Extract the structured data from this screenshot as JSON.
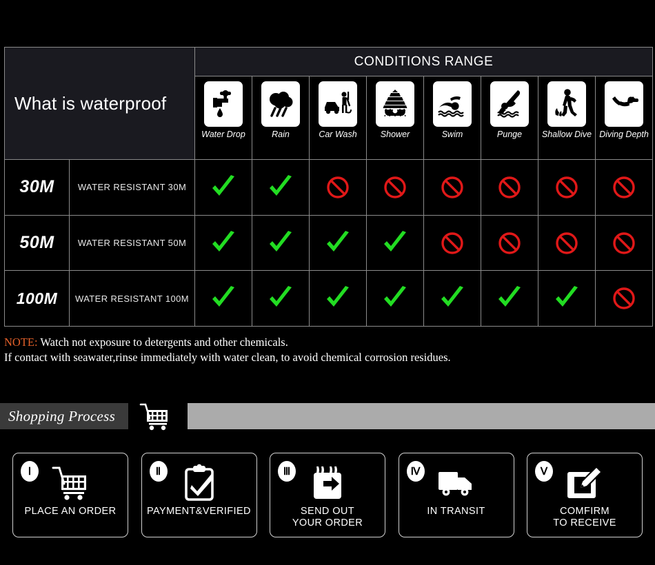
{
  "table": {
    "title": "What is waterproof",
    "conditions_header": "CONDITIONS RANGE",
    "columns": [
      {
        "label": "Water Drop",
        "icon": "faucet-water-drop-icon"
      },
      {
        "label": "Rain",
        "icon": "rain-cloud-icon"
      },
      {
        "label": "Car Wash",
        "icon": "car-wash-icon"
      },
      {
        "label": "Shower",
        "icon": "shower-icon"
      },
      {
        "label": "Swim",
        "icon": "swimmer-icon"
      },
      {
        "label": "Punge",
        "icon": "plunge-dive-icon"
      },
      {
        "label": "Shallow Dive",
        "icon": "shallow-dive-icon"
      },
      {
        "label": "Diving Depth",
        "icon": "scuba-diver-icon"
      }
    ],
    "rows": [
      {
        "depth": "30M",
        "description": "WATER RESISTANT  30M",
        "marks": [
          "yes",
          "yes",
          "no",
          "no",
          "no",
          "no",
          "no",
          "no"
        ]
      },
      {
        "depth": "50M",
        "description": "WATER RESISTANT 50M",
        "marks": [
          "yes",
          "yes",
          "yes",
          "yes",
          "no",
          "no",
          "no",
          "no"
        ]
      },
      {
        "depth": "100M",
        "description": "WATER RESISTANT  100M",
        "marks": [
          "yes",
          "yes",
          "yes",
          "yes",
          "yes",
          "yes",
          "yes",
          "no"
        ]
      }
    ]
  },
  "note": {
    "keyword": "NOTE:",
    "line1": " Watch not exposure to detergents and other chemicals.",
    "line2": "If contact with seawater,rinse immediately with water clean, to avoid chemical corrosion residues."
  },
  "shopping": {
    "tab_label": "Shopping Process",
    "cart_icon": "shopping-cart-icon",
    "steps": [
      {
        "numeral": "Ⅰ",
        "label": "PLACE AN ORDER",
        "icon": "shopping-cart-icon"
      },
      {
        "numeral": "Ⅱ",
        "label": "PAYMENT&VERIFIED",
        "icon": "clipboard-check-icon"
      },
      {
        "numeral": "Ⅲ",
        "label": "SEND OUT\nYOUR ORDER",
        "icon": "calendar-arrow-icon"
      },
      {
        "numeral": "Ⅳ",
        "label": "IN TRANSIT",
        "icon": "delivery-truck-icon"
      },
      {
        "numeral": "Ⅴ",
        "label": "COMFIRM\nTO RECEIVE",
        "icon": "edit-pencil-box-icon"
      }
    ]
  },
  "colors": {
    "check_green": "#22dd22",
    "forbidden_red": "#e01818",
    "note_keyword": "#e2602a",
    "gray_bar": "#ababab",
    "tab_bg": "#3a3a3a"
  }
}
